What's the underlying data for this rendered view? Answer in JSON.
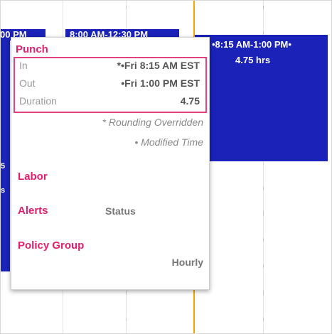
{
  "colors": {
    "shift_blue": "#1a22b8",
    "accent_pink": "#e0206f",
    "highlight_border": "#e2407f",
    "current_time_line": "#f0a800"
  },
  "calendar": {
    "shift_left_partial": "00 PM",
    "shift_middle_header": "8:00 AM-12:30 PM",
    "shift_right_time": "•8:15 AM-1:00 PM•",
    "shift_right_hours": "4.75 hrs",
    "left_edge_char_1": "5",
    "left_edge_char_2": "s"
  },
  "popover": {
    "punch_title": "Punch",
    "rows": [
      {
        "label": "In",
        "value": "*•Fri 8:15 AM EST"
      },
      {
        "label": "Out",
        "value": "•Fri 1:00 PM EST"
      },
      {
        "label": "Duration",
        "value": "4.75"
      }
    ],
    "note_rounding": "* Rounding Overridden",
    "note_modified": "• Modified Time",
    "labor_title": "Labor",
    "alerts_title": "Alerts",
    "alerts_status": "Status",
    "policy_group_title": "Policy Group",
    "policy_group_value": "Hourly"
  }
}
